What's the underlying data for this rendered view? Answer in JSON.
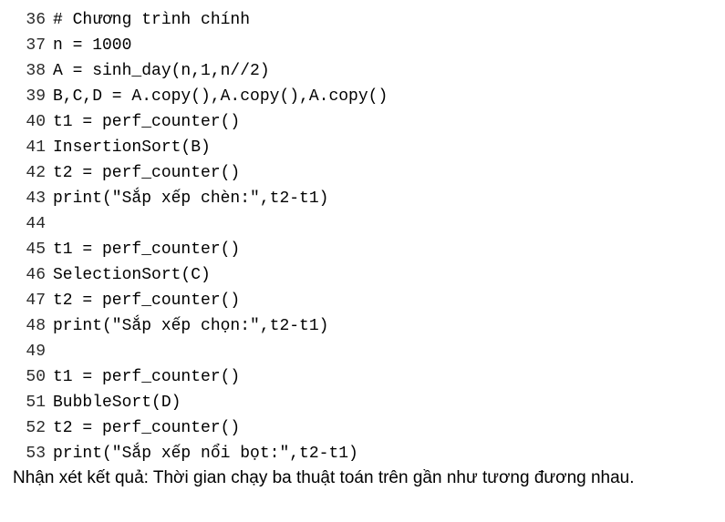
{
  "code": {
    "lines": [
      {
        "num": "36",
        "text": "# Chương trình chính"
      },
      {
        "num": "37",
        "text": "n = 1000"
      },
      {
        "num": "38",
        "text": "A = sinh_day(n,1,n//2)"
      },
      {
        "num": "39",
        "text": "B,C,D = A.copy(),A.copy(),A.copy()"
      },
      {
        "num": "40",
        "text": "t1 = perf_counter()"
      },
      {
        "num": "41",
        "text": "InsertionSort(B)"
      },
      {
        "num": "42",
        "text": "t2 = perf_counter()"
      },
      {
        "num": "43",
        "text": "print(\"Sắp xếp chèn:\",t2-t1)"
      },
      {
        "num": "44",
        "text": ""
      },
      {
        "num": "45",
        "text": "t1 = perf_counter()"
      },
      {
        "num": "46",
        "text": "SelectionSort(C)"
      },
      {
        "num": "47",
        "text": "t2 = perf_counter()"
      },
      {
        "num": "48",
        "text": "print(\"Sắp xếp chọn:\",t2-t1)"
      },
      {
        "num": "49",
        "text": ""
      },
      {
        "num": "50",
        "text": "t1 = perf_counter()"
      },
      {
        "num": "51",
        "text": "BubbleSort(D)"
      },
      {
        "num": "52",
        "text": "t2 = perf_counter()"
      },
      {
        "num": "53",
        "text": "print(\"Sắp xếp nổi bọt:\",t2-t1)"
      }
    ]
  },
  "footer": {
    "note": "Nhận xét kết quả: Thời gian chạy ba thuật toán trên gần như tương đương nhau."
  }
}
